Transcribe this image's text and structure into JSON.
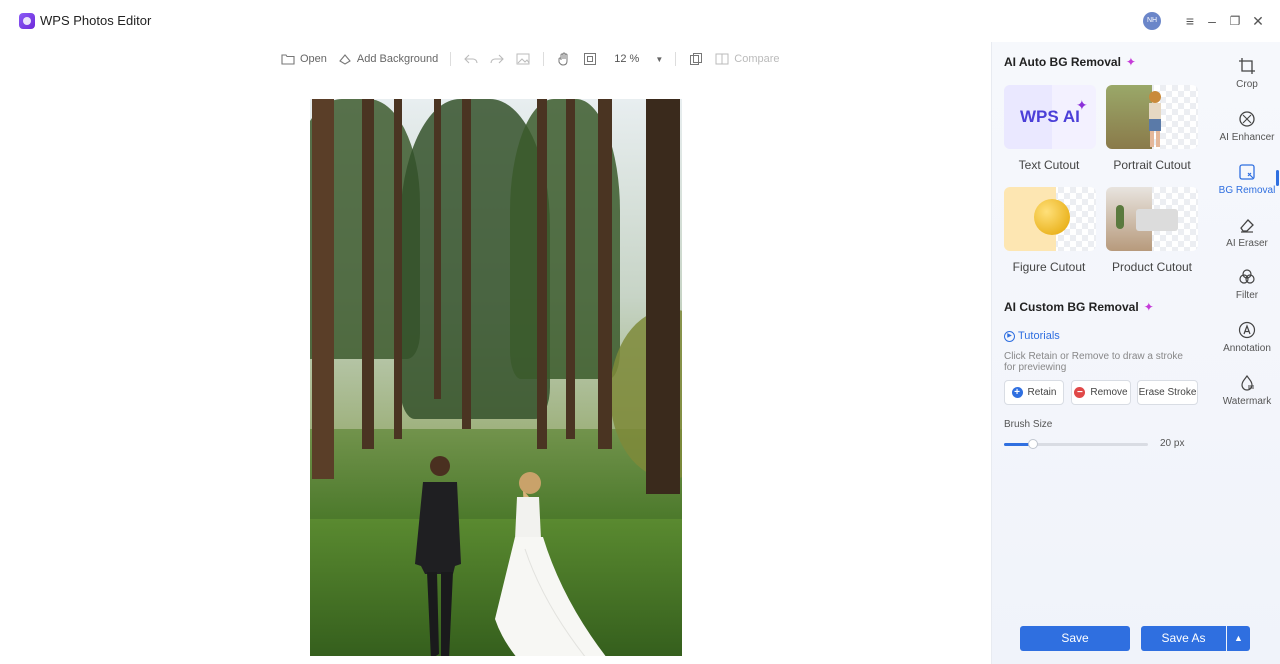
{
  "app": {
    "title": "WPS Photos Editor",
    "avatar_initials": "NH"
  },
  "toolbar": {
    "open": "Open",
    "add_background": "Add Background",
    "zoom": "12 %",
    "compare": "Compare"
  },
  "panel": {
    "auto_title": "AI Auto BG Removal",
    "sparkle": "✦",
    "cards": [
      {
        "label": "Text Cutout",
        "art_text": "WPS AI"
      },
      {
        "label": "Portrait Cutout"
      },
      {
        "label": "Figure Cutout"
      },
      {
        "label": "Product Cutout"
      }
    ],
    "custom_title": "AI Custom BG Removal",
    "tutorials": "Tutorials",
    "hint": "Click Retain or Remove to draw a stroke for previewing",
    "retain": "Retain",
    "remove": "Remove",
    "erase_stroke": "Erase Stroke",
    "brush_size_label": "Brush Size",
    "brush_size_value": "20 px",
    "brush_size_fraction": 0.2
  },
  "tools": [
    {
      "label": "Crop",
      "icon": "crop-icon"
    },
    {
      "label": "AI Enhancer",
      "icon": "ai-enhancer-icon"
    },
    {
      "label": "BG Removal",
      "icon": "bg-removal-icon",
      "active": true
    },
    {
      "label": "AI Eraser",
      "icon": "eraser-icon"
    },
    {
      "label": "Filter",
      "icon": "filter-icon"
    },
    {
      "label": "Annotation",
      "icon": "annotation-icon"
    },
    {
      "label": "Watermark",
      "icon": "watermark-icon"
    }
  ],
  "footer": {
    "save": "Save",
    "save_as": "Save As"
  },
  "colors": {
    "accent": "#2f6fe0",
    "sparkle": "#c53ad8"
  }
}
